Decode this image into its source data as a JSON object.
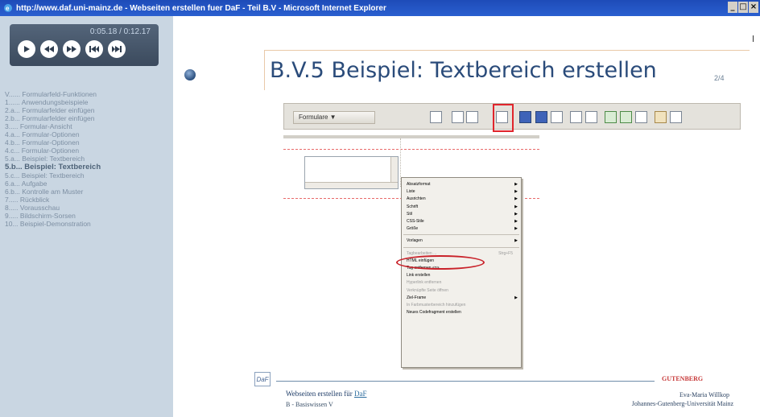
{
  "window": {
    "title": "http://www.daf.uni-mainz.de - Webseiten erstellen fuer DaF - Teil B.V - Microsoft Internet Explorer",
    "buttons": [
      "_",
      "□",
      "×"
    ]
  },
  "player": {
    "time": "0:05.18 / 0:12.17",
    "controls": [
      "play-icon",
      "previous-icon",
      "next-icon",
      "rewind-icon",
      "fast-forward-icon"
    ]
  },
  "nav": {
    "items": [
      "V...... Formularfeld-Funktionen",
      "1...... Anwendungsbeispiele",
      "2.a... Formularfelder einfügen",
      "2.b... Formularfelder einfügen",
      "3..... Formular-Ansicht",
      "4.a... Formular-Optionen",
      "4.b... Formular-Optionen",
      "4.c... Formular-Optionen",
      "5.a... Beispiel: Textbereich",
      "5.b... Beispiel: Textbereich",
      "5.c... Beispiel: Textbereich",
      "6.a... Aufgabe",
      "6.b... Kontrolle am Muster",
      "7..... Rückblick",
      "8..... Vorausschau",
      "9..... Bildschirm-Sorsen",
      "10... Beispiel-Demonstration"
    ],
    "active_index": 9
  },
  "content": {
    "title": "B.V.5 Beispiel: Textbereich erstellen",
    "page": "2/4"
  },
  "toolbar": {
    "dropdown": "Formulare ▼"
  },
  "context_menu": {
    "items": [
      {
        "label": "Absatzformat",
        "sub": true
      },
      {
        "label": "Liste",
        "sub": true
      },
      {
        "label": "Ausrichten",
        "sub": true
      },
      {
        "label": "Schrift",
        "sub": true
      },
      {
        "label": "Stil",
        "sub": true
      },
      {
        "label": "CSS-Stile",
        "sub": true
      },
      {
        "label": "Größe",
        "sub": true
      },
      {
        "sep": true
      },
      {
        "label": "Vorlagen",
        "sub": true
      },
      {
        "sep": true
      },
      {
        "label": "Tagbearbeiten ...",
        "shortcut": "Strg+F5",
        "dim": true
      },
      {
        "label": "HTML einfügen"
      },
      {
        "label": "Tag entfernen <p>"
      },
      {
        "label": "Link erstellen"
      },
      {
        "label": "Hyperlink entfernen",
        "dim": true
      },
      {
        "label": "Verknüpfte Seite öffnen",
        "dim": true
      },
      {
        "label": "Ziel-Frame",
        "sub": true
      },
      {
        "label": "In Farbmusterbereich hinzufügen",
        "dim": true
      },
      {
        "label": "Neues Codefragment erstellen"
      }
    ]
  },
  "footer": {
    "logo": "DaF",
    "brand": "GUTENBERG",
    "left_title": "Webseiten erstellen für ",
    "left_link": "DaF",
    "left_sub": "B - Basiswissen V",
    "right_name": "Eva-Maria Willkop",
    "right_org": "Johannes-Gutenberg-Universität Mainz"
  },
  "colors": {
    "sidebar_bg": "#c9d6e2",
    "title_color": "#2a4b7a",
    "highlight": "#e0252c"
  }
}
